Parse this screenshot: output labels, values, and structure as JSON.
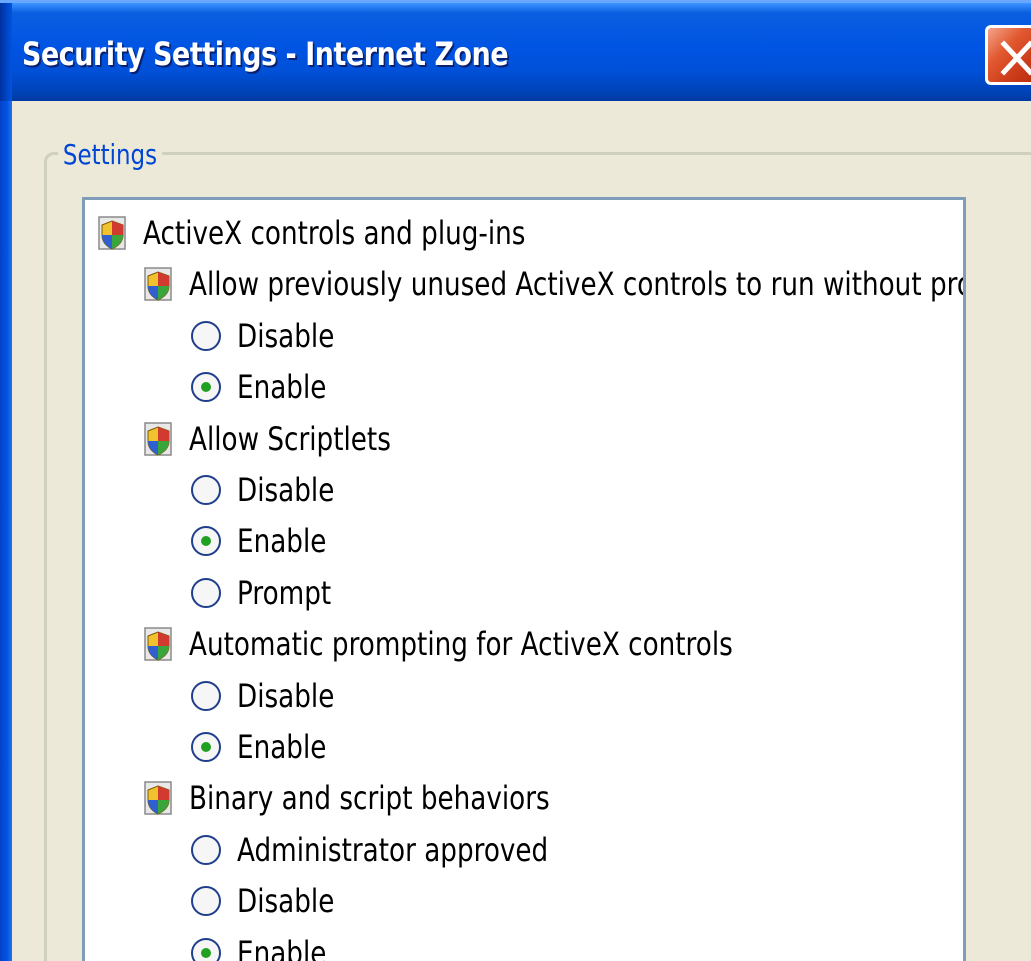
{
  "window": {
    "title": "Security Settings - Internet Zone",
    "close_label": "X"
  },
  "settings_group": {
    "legend": "Settings"
  },
  "tree": {
    "category": "ActiveX controls and plug-ins",
    "settings": [
      {
        "label": "Allow previously unused ActiveX controls to run without prom",
        "options": [
          {
            "label": "Disable",
            "selected": false
          },
          {
            "label": "Enable",
            "selected": true
          }
        ]
      },
      {
        "label": "Allow Scriptlets",
        "options": [
          {
            "label": "Disable",
            "selected": false
          },
          {
            "label": "Enable",
            "selected": true
          },
          {
            "label": "Prompt",
            "selected": false
          }
        ]
      },
      {
        "label": "Automatic prompting for ActiveX controls",
        "options": [
          {
            "label": "Disable",
            "selected": false
          },
          {
            "label": "Enable",
            "selected": true
          }
        ]
      },
      {
        "label": "Binary and script behaviors",
        "options": [
          {
            "label": "Administrator approved",
            "selected": false
          },
          {
            "label": "Disable",
            "selected": false
          },
          {
            "label": "Enable",
            "selected": true
          }
        ]
      }
    ]
  },
  "colors": {
    "titlebar": "#0054e3",
    "close_button": "#d9471f",
    "group_legend": "#0046d5",
    "radio_selected_dot": "#21a121",
    "dialog_background": "#ece9d8"
  },
  "icons": {
    "category": "shield-icon",
    "setting": "shield-icon",
    "close": "close-icon",
    "scroll_up": "chevron-up-icon",
    "scroll_thumb": "grip-icon"
  }
}
